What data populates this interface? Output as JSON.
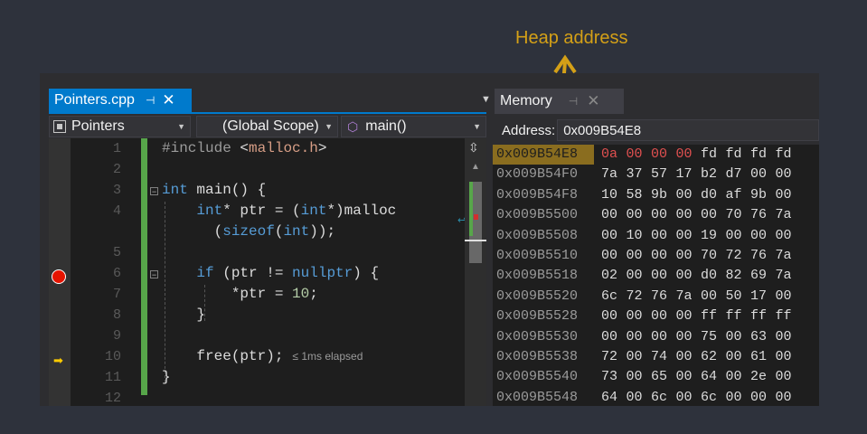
{
  "callout": {
    "text": "Heap address",
    "color": "#d4a017"
  },
  "editor": {
    "tab": {
      "title": "Pointers.cpp",
      "pin_icon": "pin-icon",
      "close_icon": "close-icon"
    },
    "nav": {
      "project": "Pointers",
      "scope": "(Global Scope)",
      "member": "main()"
    },
    "line_numbers": [
      "1",
      "2",
      "3",
      "4",
      "",
      "5",
      "6",
      "7",
      "8",
      "9",
      "10",
      "11",
      "12"
    ],
    "elapsed": "≤ 1ms elapsed",
    "colors": {
      "keyword": "#569cd6",
      "string": "#d69d85",
      "number": "#b5cea8",
      "change": "#57a64a"
    }
  },
  "memory": {
    "tab": {
      "title": "Memory",
      "pin_icon": "pin-icon",
      "close_icon": "close-icon"
    },
    "address_label": "Address:",
    "address_value": "0x009B54E8",
    "rows": [
      {
        "addr": "0x009B54E8",
        "bytes": [
          "0a",
          "00",
          "00",
          "00",
          "fd",
          "fd",
          "fd",
          "fd"
        ]
      },
      {
        "addr": "0x009B54F0",
        "bytes": [
          "7a",
          "37",
          "57",
          "17",
          "b2",
          "d7",
          "00",
          "00"
        ]
      },
      {
        "addr": "0x009B54F8",
        "bytes": [
          "10",
          "58",
          "9b",
          "00",
          "d0",
          "af",
          "9b",
          "00"
        ]
      },
      {
        "addr": "0x009B5500",
        "bytes": [
          "00",
          "00",
          "00",
          "00",
          "00",
          "70",
          "76",
          "7a"
        ]
      },
      {
        "addr": "0x009B5508",
        "bytes": [
          "00",
          "10",
          "00",
          "00",
          "19",
          "00",
          "00",
          "00"
        ]
      },
      {
        "addr": "0x009B5510",
        "bytes": [
          "00",
          "00",
          "00",
          "00",
          "70",
          "72",
          "76",
          "7a"
        ]
      },
      {
        "addr": "0x009B5518",
        "bytes": [
          "02",
          "00",
          "00",
          "00",
          "d0",
          "82",
          "69",
          "7a"
        ]
      },
      {
        "addr": "0x009B5520",
        "bytes": [
          "6c",
          "72",
          "76",
          "7a",
          "00",
          "50",
          "17",
          "00"
        ]
      },
      {
        "addr": "0x009B5528",
        "bytes": [
          "00",
          "00",
          "00",
          "00",
          "ff",
          "ff",
          "ff",
          "ff"
        ]
      },
      {
        "addr": "0x009B5530",
        "bytes": [
          "00",
          "00",
          "00",
          "00",
          "75",
          "00",
          "63",
          "00"
        ]
      },
      {
        "addr": "0x009B5538",
        "bytes": [
          "72",
          "00",
          "74",
          "00",
          "62",
          "00",
          "61",
          "00"
        ]
      },
      {
        "addr": "0x009B5540",
        "bytes": [
          "73",
          "00",
          "65",
          "00",
          "64",
          "00",
          "2e",
          "00"
        ]
      },
      {
        "addr": "0x009B5548",
        "bytes": [
          "64",
          "00",
          "6c",
          "00",
          "6c",
          "00",
          "00",
          "00"
        ]
      }
    ]
  }
}
